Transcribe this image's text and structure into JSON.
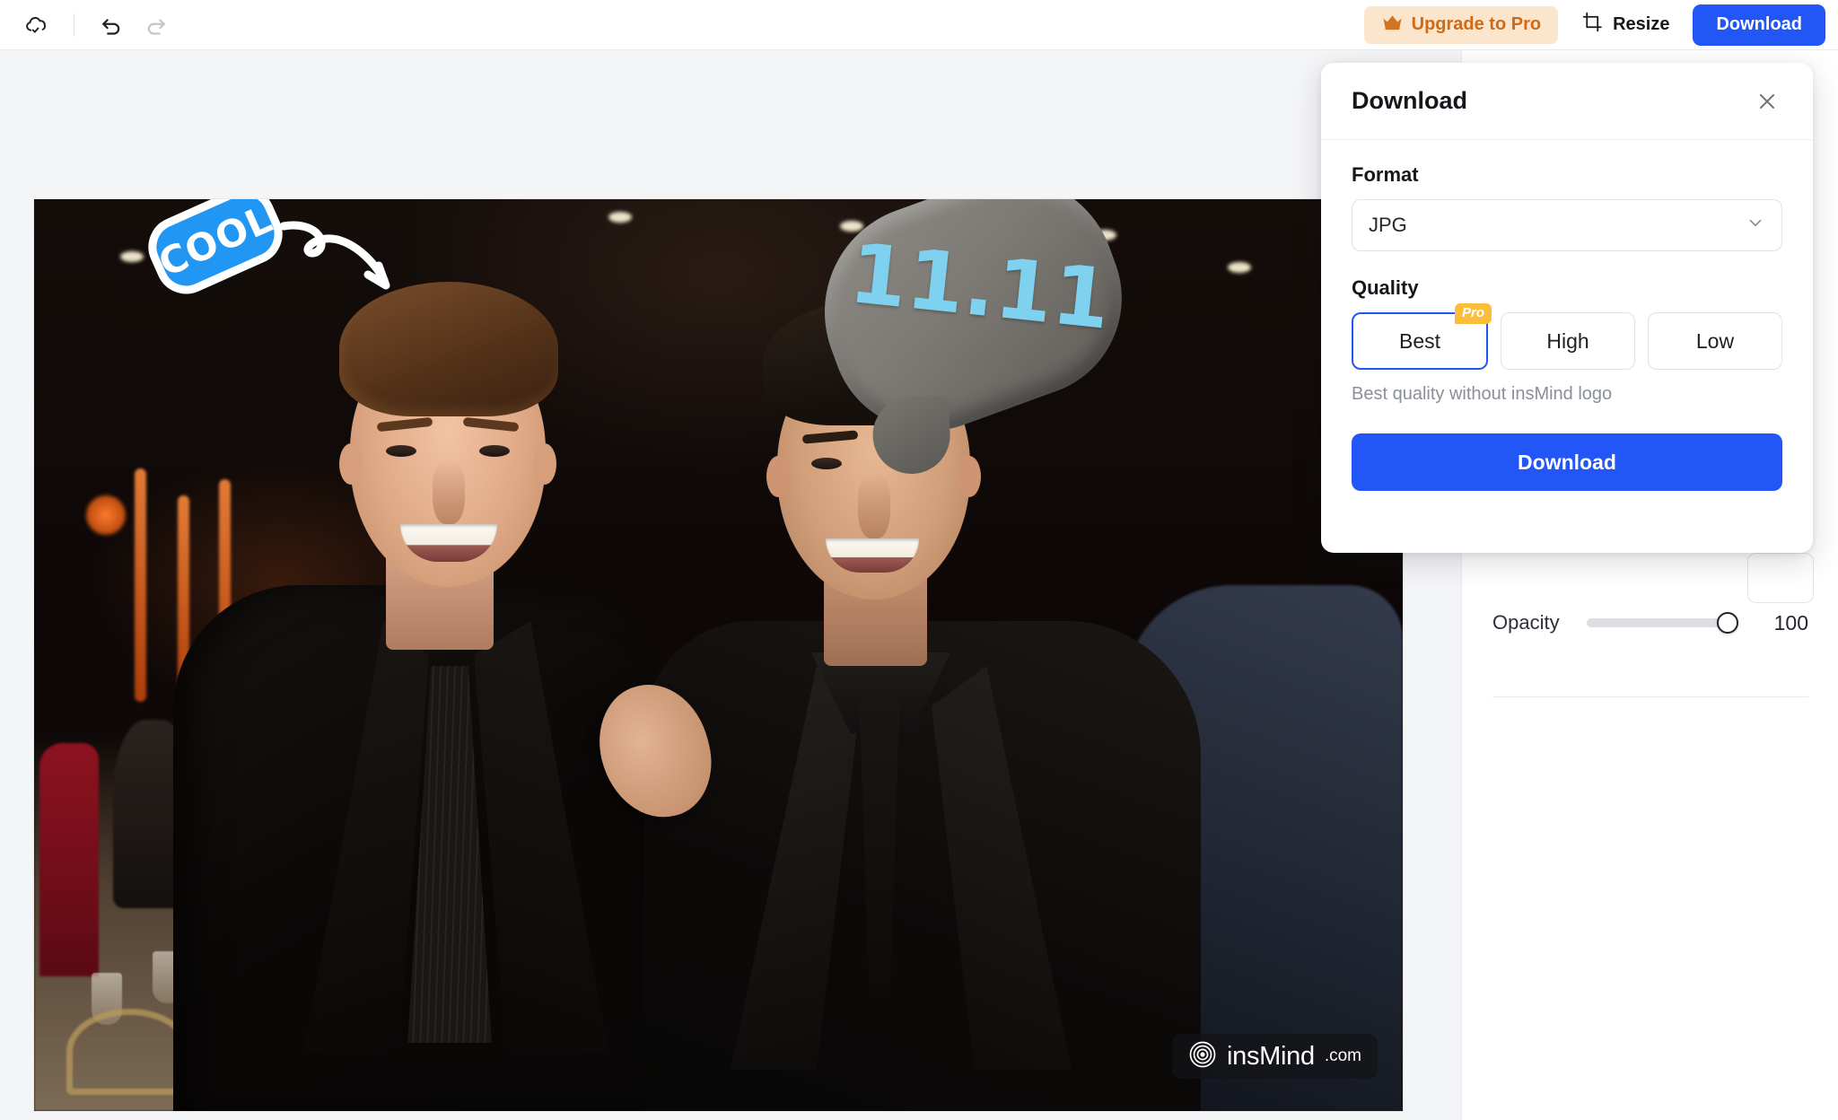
{
  "toolbar": {
    "cloud_save_icon": "cloud-check-icon",
    "undo_icon": "undo-icon",
    "redo_icon": "redo-icon",
    "upgrade_label": "Upgrade to Pro",
    "upgrade_icon": "crown-icon",
    "resize_label": "Resize",
    "resize_icon": "crop-resize-icon",
    "download_label": "Download",
    "accent_blue": "#2356f6",
    "upgrade_bg": "#fbe6cd",
    "upgrade_text": "#cf6a19"
  },
  "canvas": {
    "stickers": {
      "cool": {
        "text": "COOL",
        "color": "#2196f3",
        "outline": "#ffffff"
      },
      "sale": {
        "text": "11.11",
        "text_color": "#7fd1f0",
        "bubble_color": "#7d7a75"
      }
    },
    "watermark": {
      "name": "insMind",
      "domain": ".com",
      "logo_icon": "spiral-logo-icon"
    }
  },
  "sidebar": {
    "opacity_label": "Opacity",
    "opacity_value": "100"
  },
  "download_panel": {
    "title": "Download",
    "close_icon": "close-icon",
    "format_label": "Format",
    "format_value": "JPG",
    "format_chevron_icon": "chevron-down-icon",
    "quality_label": "Quality",
    "quality_options": [
      {
        "label": "Best",
        "badge": "Pro",
        "selected": true
      },
      {
        "label": "High",
        "badge": "",
        "selected": false
      },
      {
        "label": "Low",
        "badge": "",
        "selected": false
      }
    ],
    "quality_note": "Best quality without insMind logo",
    "action_label": "Download",
    "badge_color": "#fbbe3c",
    "selected_border": "#2356f6"
  }
}
